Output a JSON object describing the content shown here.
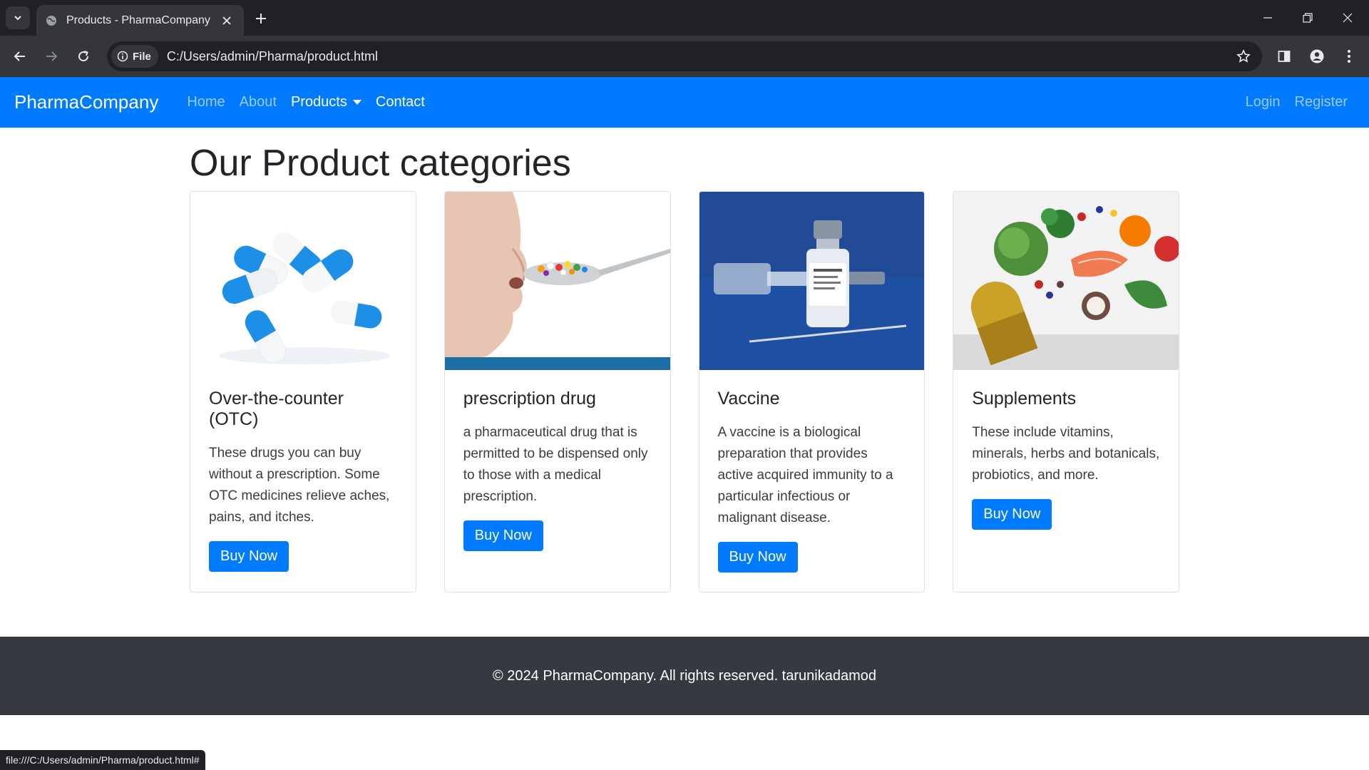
{
  "browser": {
    "tab_title": "Products - PharmaCompany",
    "site_chip": "File",
    "url": "C:/Users/admin/Pharma/product.html",
    "status_url": "file:///C:/Users/admin/Pharma/product.html#"
  },
  "navbar": {
    "brand": "PharmaCompany",
    "links": [
      "Home",
      "About",
      "Products",
      "Contact"
    ],
    "right_links": [
      "Login",
      "Register"
    ]
  },
  "main": {
    "heading": "Our Product categories",
    "cards": [
      {
        "title": "Over-the-counter (OTC)",
        "text": "These drugs you can buy without a prescription. Some OTC medicines relieve aches, pains, and itches.",
        "button": "Buy Now",
        "image_icon": "capsules-image"
      },
      {
        "title": "prescription drug",
        "text": "a pharmaceutical drug that is permitted to be dispensed only to those with a medical prescription.",
        "button": "Buy Now",
        "image_icon": "spoon-pills-image"
      },
      {
        "title": "Vaccine",
        "text": "A vaccine is a biological preparation that provides active acquired immunity to a particular infectious or malignant disease.",
        "button": "Buy Now",
        "image_icon": "vaccine-vial-image"
      },
      {
        "title": "Supplements",
        "text": "These include vitamins, minerals, herbs and botanicals, probiotics, and more.",
        "button": "Buy Now",
        "image_icon": "supplements-image"
      }
    ]
  },
  "footer": {
    "text": "© 2024 PharmaCompany. All rights reserved. tarunikadamod"
  },
  "colors": {
    "primary": "#007bff",
    "footer_bg": "#343a40",
    "chrome_dark": "#202124",
    "chrome_toolbar": "#35363a"
  }
}
